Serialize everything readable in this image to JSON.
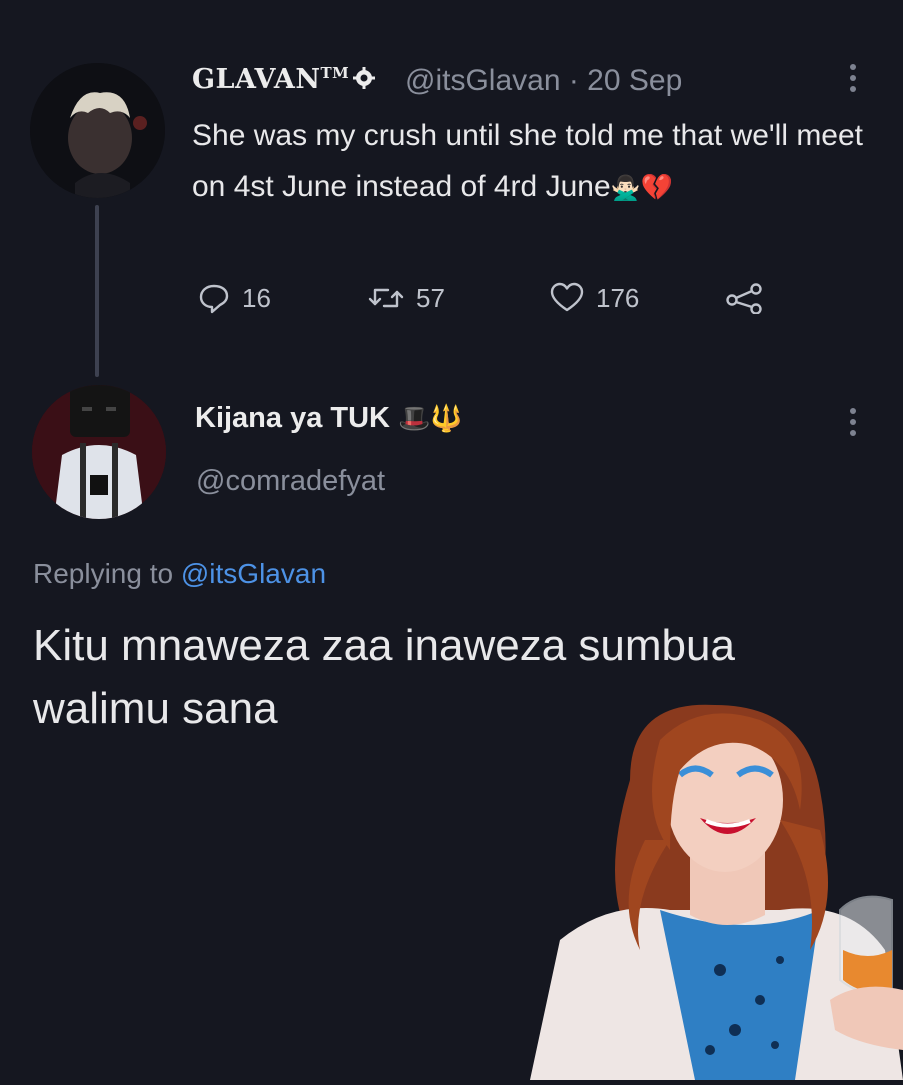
{
  "original_tweet": {
    "display_name": "GLAVAN",
    "tm": "TM",
    "handle_time": "@itsGlavan · 20 Sep",
    "text": "She was my crush until she told me that we'll meet on 4st June instead of 4rd June",
    "emoji_1": "🙅🏻‍♂️",
    "emoji_2": "💔",
    "stats": {
      "replies": "16",
      "retweets": "57",
      "likes": "176"
    }
  },
  "reply_tweet": {
    "display_name": "Kijana ya TUK",
    "emojis": "🎩🔱",
    "handle": "@comradefyat",
    "replying_prefix": "Replying to",
    "replying_to": "@itsGlavan",
    "text": "Kitu mnaweza zaa inaweza sumbua walimu sana"
  },
  "colors": {
    "background": "#151720",
    "text_primary": "#e8e8ea",
    "text_secondary": "#8a8f9c",
    "link": "#4d92e6",
    "heart_red": "#d7263d"
  },
  "icons": [
    "reply-icon",
    "retweet-icon",
    "like-icon",
    "share-icon",
    "more-options-icon",
    "verified-badge-icon"
  ]
}
